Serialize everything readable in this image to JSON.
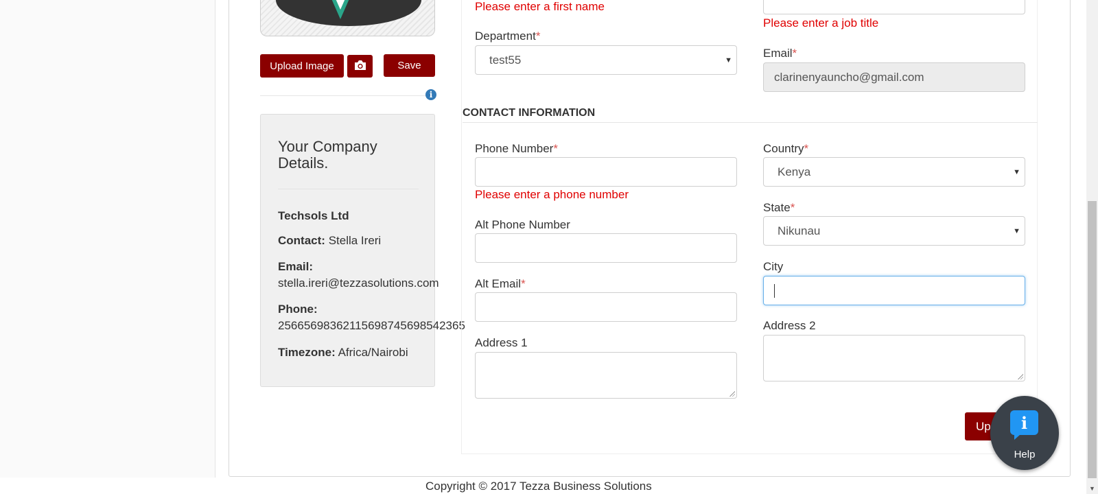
{
  "sidebar": {
    "upload_label": "Upload Image",
    "save_label": "Save"
  },
  "company": {
    "title": "Your Company Details.",
    "name": "Techsols Ltd",
    "contact_label": "Contact:",
    "contact_value": "Stella Ireri",
    "email_label": "Email:",
    "email_value": "stella.ireri@tezzasolutions.com",
    "phone_label": "Phone:",
    "phone_value": "25665698362115698745698542365",
    "timezone_label": "Timezone:",
    "timezone_value": "Africa/Nairobi"
  },
  "form": {
    "first_name_error": "Please enter a first name",
    "job_title_error": "Please enter a job title",
    "department_label": "Department",
    "department_value": "test55",
    "email_label": "Email",
    "email_value": "clarinenyauncho@gmail.com",
    "section_title": "CONTACT INFORMATION",
    "phone_label": "Phone Number",
    "phone_error": "Please enter a phone number",
    "country_label": "Country",
    "country_value": "Kenya",
    "alt_phone_label": "Alt Phone Number",
    "state_label": "State",
    "state_value": "Nikunau",
    "alt_email_label": "Alt Email",
    "city_label": "City",
    "address1_label": "Address 1",
    "address2_label": "Address 2",
    "update_label": "Up",
    "required_mark": "*"
  },
  "help": {
    "label": "Help"
  },
  "footer": {
    "copyright": "Copyright © 2017 Tezza Business Solutions"
  },
  "colors": {
    "accent": "#8b0000",
    "error": "#e00000",
    "focus": "#66afe9",
    "help_icon": "#2196f3"
  },
  "icons": {
    "camera": "camera-icon",
    "info": "info-icon",
    "help": "help-chat-icon"
  }
}
